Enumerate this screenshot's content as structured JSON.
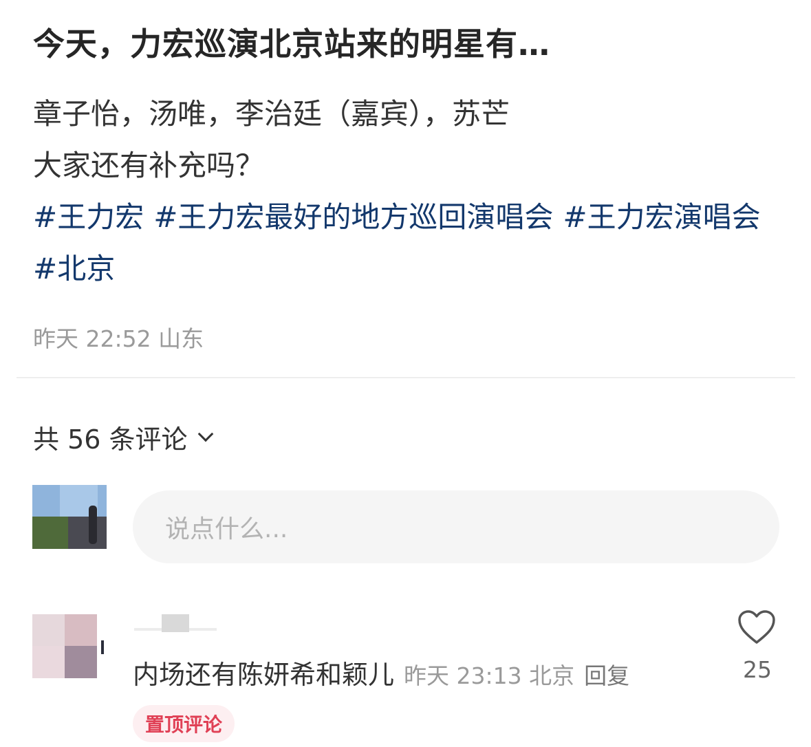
{
  "post": {
    "title": "今天，力宏巡演北京站来的明星有…",
    "body_line1": "章子怡，汤唯，李治廷（嘉宾），苏芒",
    "body_line2": "大家还有补充吗？",
    "tags": [
      "#王力宏",
      "#王力宏最好的地方巡回演唱会",
      "#王力宏演唱会",
      "#北京"
    ],
    "meta": "昨天 22:52 山东"
  },
  "comments_header": {
    "label": "共 56 条评论"
  },
  "input": {
    "placeholder": "说点什么..."
  },
  "comment": {
    "text": "内场还有陈妍希和颖儿",
    "meta": "昨天 23:13 北京",
    "reply_label": "回复",
    "likes": "25",
    "pinned_label": "置顶评论"
  },
  "colors": {
    "tag_color": "#13386c",
    "meta_color": "#9a9a9a",
    "pinned_color": "#e04055"
  }
}
